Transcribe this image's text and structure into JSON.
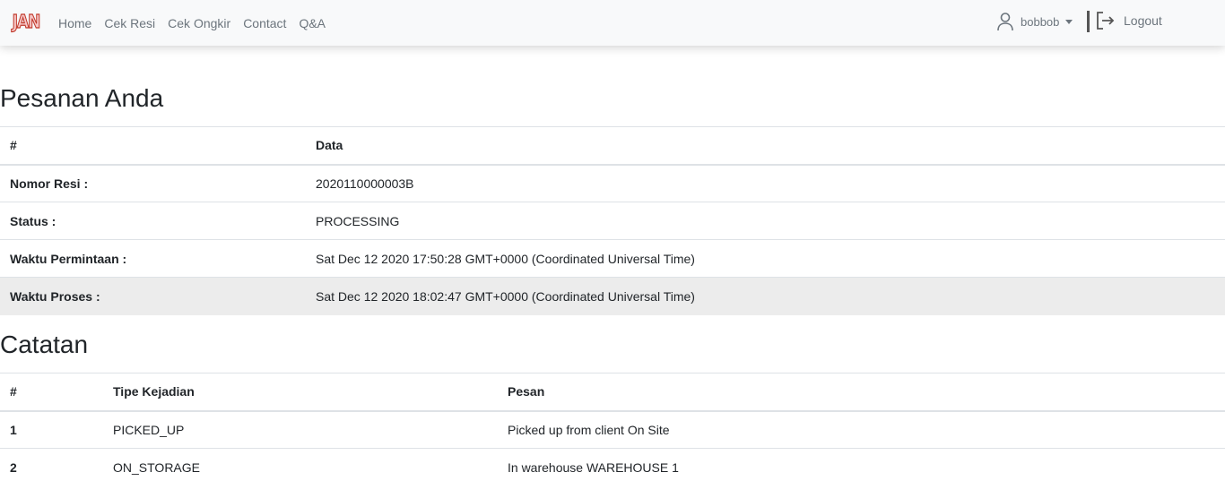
{
  "nav": {
    "brand": "JAN",
    "links": [
      "Home",
      "Cek Resi",
      "Cek Ongkir",
      "Contact",
      "Q&A"
    ],
    "username": "bobbob",
    "logout": "Logout"
  },
  "order": {
    "heading": "Pesanan Anda",
    "columns": [
      "#",
      "Data"
    ],
    "rows": [
      {
        "label": "Nomor Resi :",
        "value": "2020110000003B"
      },
      {
        "label": "Status :",
        "value": "PROCESSING"
      },
      {
        "label": "Waktu Permintaan :",
        "value": "Sat Dec 12 2020 17:50:28 GMT+0000 (Coordinated Universal Time)"
      },
      {
        "label": "Waktu Proses :",
        "value": "Sat Dec 12 2020 18:02:47 GMT+0000 (Coordinated Universal Time)"
      }
    ]
  },
  "notes": {
    "heading": "Catatan",
    "columns": [
      "#",
      "Tipe Kejadian",
      "Pesan"
    ],
    "rows": [
      {
        "no": "1",
        "type": "PICKED_UP",
        "message": "Picked up from client On Site"
      },
      {
        "no": "2",
        "type": "ON_STORAGE",
        "message": "In warehouse WAREHOUSE 1"
      }
    ]
  }
}
